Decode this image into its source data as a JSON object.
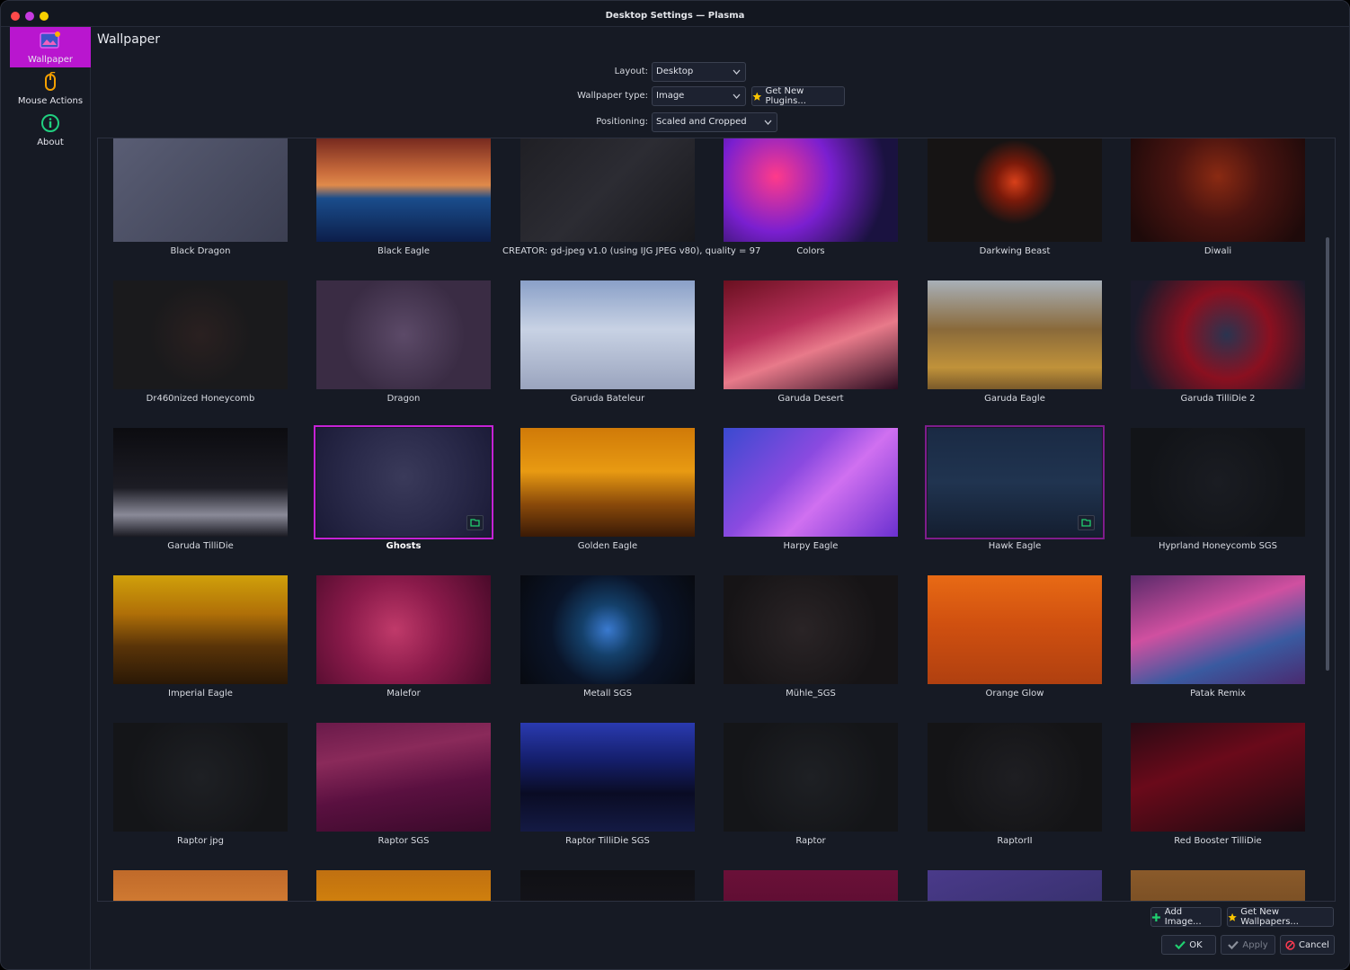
{
  "window": {
    "title": "Desktop Settings — Plasma"
  },
  "sidebar": {
    "items": [
      {
        "label": "Wallpaper",
        "icon": "wallpaper-icon",
        "active": true
      },
      {
        "label": "Mouse Actions",
        "icon": "mouse-icon",
        "active": false
      },
      {
        "label": "About",
        "icon": "info-icon",
        "active": false
      }
    ]
  },
  "page": {
    "title": "Wallpaper",
    "layout_label": "Layout:",
    "layout_value": "Desktop",
    "type_label": "Wallpaper type:",
    "type_value": "Image",
    "plugins_button": "Get New Plugins...",
    "positioning_label": "Positioning:",
    "positioning_value": "Scaled and Cropped"
  },
  "wallpapers": [
    {
      "name": "Black Dragon",
      "bg": "linear-gradient(135deg,#5a5e75,#3c3f52)"
    },
    {
      "name": "Black Eagle",
      "bg": "linear-gradient(180deg,#6a1f1a 0%,#c76a3b 35%,#e08a4a 48%,#1a4d8c 60%,#0c1e4a 100%)"
    },
    {
      "name": "CREATOR: gd-jpeg v1.0 (using IJG JPEG v80), quality = 97",
      "bg": "linear-gradient(135deg,#1f1f24 0%,#2c2c33 50%,#18181c 100%)"
    },
    {
      "name": "Colors",
      "bg": "radial-gradient(circle at 30% 40%,#ff3a8a,#7a1fd0 40%,#1a1240 80%)"
    },
    {
      "name": "Darkwing Beast",
      "bg": "radial-gradient(circle at 50% 45%,#d8401a 0%,#7a1a0a 18%,#161414 40%)"
    },
    {
      "name": "Diwali",
      "bg": "radial-gradient(circle at 50% 40%,#8a2a12 0%,#4a1410 40%,#1e0a0a 90%)"
    },
    {
      "name": "Dr460nized Honeycomb",
      "bg": "radial-gradient(circle at 50% 50%,#2a2020 0%,#1a1a1c 50%)"
    },
    {
      "name": "Dragon",
      "bg": "radial-gradient(circle at 50% 50%,#5c4a68 0%,#3a2c44 60%)"
    },
    {
      "name": "Garuda Bateleur",
      "bg": "linear-gradient(180deg,#8aa0c8 0%,#c8d2e4 45%,#9aa4be 100%)"
    },
    {
      "name": "Garuda Desert",
      "bg": "linear-gradient(160deg,#6a1020 0%,#b8305a 40%,#e87a8a 60%,#2a0c20 100%)"
    },
    {
      "name": "Garuda Eagle",
      "bg": "linear-gradient(180deg,#a8b0b8 0%,#8a6a3a 45%,#c0923a 80%,#7a5a2a 100%)"
    },
    {
      "name": "Garuda TilliDie 2",
      "bg": "radial-gradient(circle at 55% 50%,#2a3450 0%,#8a1020 40%,#1a1a2a 85%)"
    },
    {
      "name": "Garuda TilliDie",
      "bg": "linear-gradient(180deg,#0c0c10 0%,#1c1c24 55%,#8a8a98 80%,#1a1a22 100%)"
    },
    {
      "name": "Ghosts",
      "bg": "radial-gradient(circle at 50% 45%,#3a3a5a 0%,#2a2a4a 50%,#1a1a36 100%)",
      "selected": true
    },
    {
      "name": "Golden Eagle",
      "bg": "linear-gradient(180deg,#d07a08 0%,#e89a12 40%,#8a4a0a 70%,#3a1a06 100%)"
    },
    {
      "name": "Harpy Eagle",
      "bg": "linear-gradient(135deg,#3a4ad0 0%,#8a4ae0 40%,#d070f0 60%,#6a30d0 100%)"
    },
    {
      "name": "Hawk Eagle",
      "bg": "linear-gradient(180deg,#1a2a44 0%,#203450 50%,#141e30 100%)",
      "hover": true
    },
    {
      "name": "Hyprland Honeycomb SGS",
      "bg": "radial-gradient(circle at 50% 50%,#1a1c22 0%,#121418 70%)"
    },
    {
      "name": "Imperial Eagle",
      "bg": "linear-gradient(180deg,#d0a00a 0%,#b07008 35%,#5a3408 65%,#2a1806 100%)"
    },
    {
      "name": "Malefor",
      "bg": "radial-gradient(circle at 45% 50%,#c03a6a 0%,#8a1a4a 45%,#4a0a2a 100%)"
    },
    {
      "name": "Metall SGS",
      "bg": "radial-gradient(circle at 50% 50%,#3a7ad0 0%,#14406a 25%,#0a1428 55%,#080a10 100%)"
    },
    {
      "name": "Mühle_SGS",
      "bg": "radial-gradient(circle at 45% 50%,#2a2426 0%,#161416 70%)"
    },
    {
      "name": "Orange Glow",
      "bg": "linear-gradient(180deg,#e86a14 0%,#d05010 45%,#b04010 100%)"
    },
    {
      "name": "Patak Remix",
      "bg": "linear-gradient(160deg,#5a2a6a 0%,#d050a0 40%,#3a5aa0 70%,#4a2a70 100%)"
    },
    {
      "name": "Raptor jpg",
      "bg": "radial-gradient(circle at 50% 50%,#1e2024 0%,#141518 70%)"
    },
    {
      "name": "Raptor SGS",
      "bg": "linear-gradient(170deg,#6a1a4a 0%,#8a2a5a 30%,#5a1040 60%,#3a0a2a 100%)"
    },
    {
      "name": "Raptor TilliDie SGS",
      "bg": "linear-gradient(180deg,#2a3ab0 0%,#141e6a 35%,#0a0c24 65%,#141a44 100%)"
    },
    {
      "name": "Raptor",
      "bg": "radial-gradient(circle at 50% 50%,#1e2024 0%,#141518 70%)"
    },
    {
      "name": "RaptorII",
      "bg": "radial-gradient(circle at 50% 50%,#1e1e22 0%,#141416 70%)"
    },
    {
      "name": "Red Booster TilliDie",
      "bg": "linear-gradient(160deg,#2a0a14 0%,#6a0a1a 40%,#1a0a10 100%)"
    },
    {
      "name": "",
      "bg": "linear-gradient(180deg,#c06a2a 0%,#e08a3a 60%,#d06a20 100%)"
    },
    {
      "name": "",
      "bg": "linear-gradient(180deg,#c07010 0%,#e0900a 60%,#c06008 100%)"
    },
    {
      "name": "",
      "bg": "linear-gradient(180deg,#101014 0%,#1a1a24 100%)"
    },
    {
      "name": "",
      "bg": "linear-gradient(180deg,#6a1038 0%,#4a0a28 100%)"
    },
    {
      "name": "",
      "bg": "linear-gradient(160deg,#4a3a8a 0%,#2a2a5a 100%)"
    },
    {
      "name": "",
      "bg": "linear-gradient(180deg,#8a5a2a 0%,#5a3a1a 100%)"
    }
  ],
  "footer": {
    "add_image": "Add Image...",
    "get_wallpapers": "Get New Wallpapers...",
    "ok": "OK",
    "apply": "Apply",
    "cancel": "Cancel"
  },
  "colors": {
    "accent": "#b916cf",
    "close_dot": "#ff4a4a",
    "min_dot": "#c63ae0",
    "max_dot": "#f8d000"
  }
}
